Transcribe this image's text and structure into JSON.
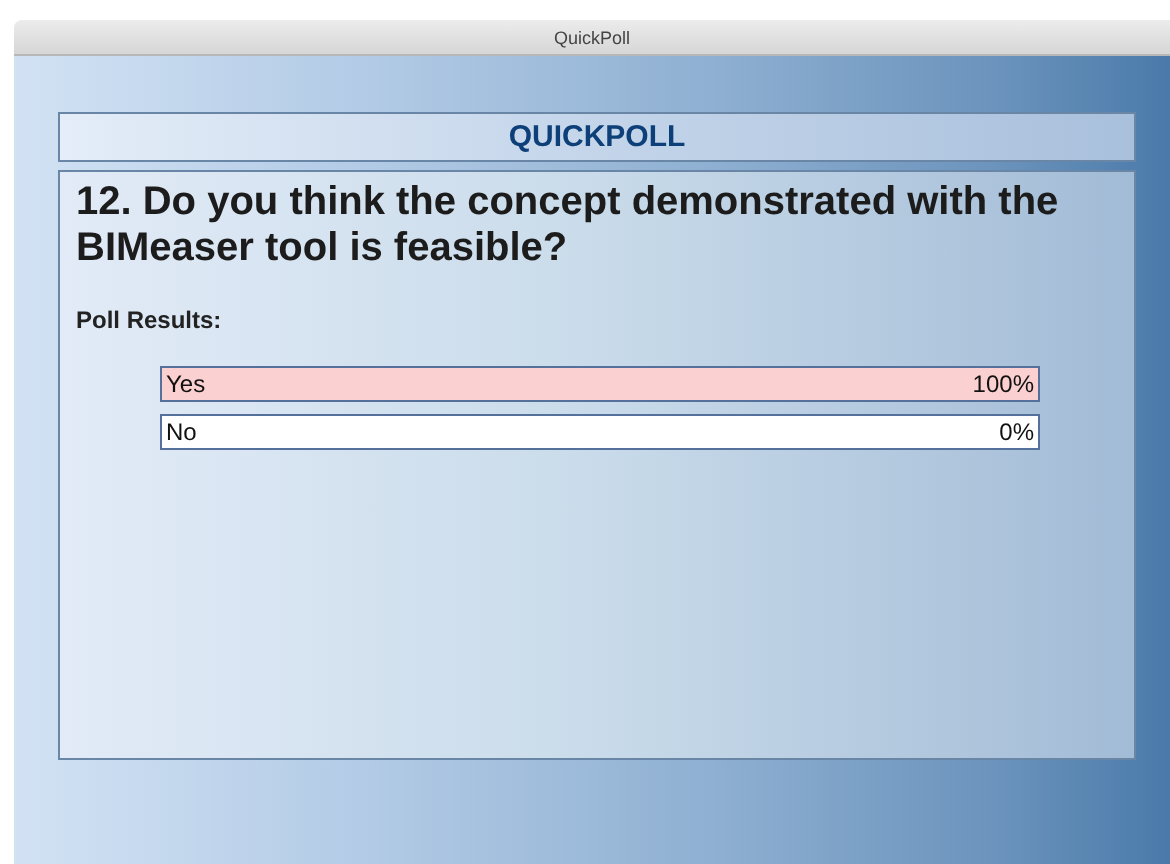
{
  "window": {
    "title": "QuickPoll"
  },
  "header": {
    "title": "QUICKPOLL"
  },
  "question": "12. Do you think the concept demonstrated with the BIMeaser tool is feasible?",
  "results_label": "Poll Results:",
  "results": [
    {
      "label": "Yes",
      "reading": "100%",
      "level": 1
    },
    {
      "label": "No",
      "reading": "0%",
      "level": 0
    }
  ]
}
